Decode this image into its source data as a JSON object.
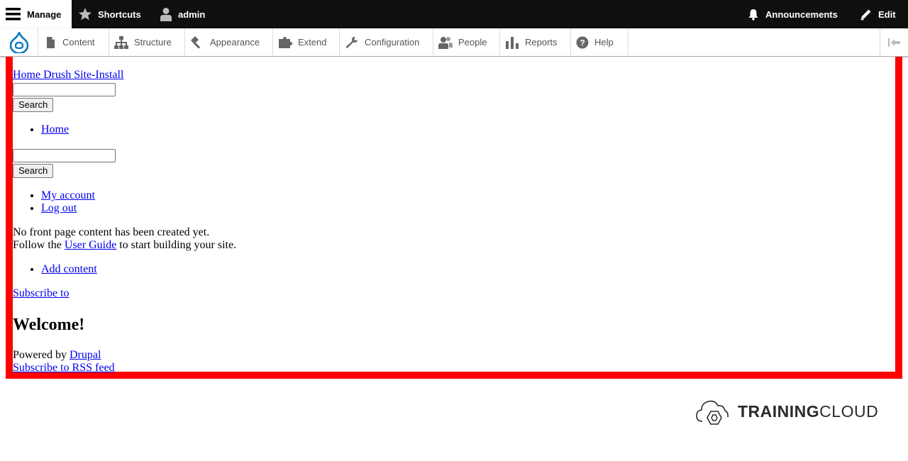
{
  "toolbar": {
    "manage": "Manage",
    "shortcuts": "Shortcuts",
    "user": "admin",
    "announcements": "Announcements",
    "edit": "Edit"
  },
  "tray": {
    "items": [
      {
        "label": "Content",
        "icon": "file-icon"
      },
      {
        "label": "Structure",
        "icon": "sitemap-icon"
      },
      {
        "label": "Appearance",
        "icon": "paintbrush-icon"
      },
      {
        "label": "Extend",
        "icon": "puzzle-icon"
      },
      {
        "label": "Configuration",
        "icon": "wrench-icon"
      },
      {
        "label": "People",
        "icon": "people-icon"
      },
      {
        "label": "Reports",
        "icon": "bar-chart-icon"
      },
      {
        "label": "Help",
        "icon": "help-icon"
      }
    ]
  },
  "page": {
    "home_link": "Home Drush Site-Install",
    "search_button": "Search",
    "main_nav": [
      "Home"
    ],
    "search_button_2": "Search",
    "account_menu": [
      "My account",
      "Log out"
    ],
    "no_content_text": "No front page content has been created yet.",
    "follow_prefix": "Follow the",
    "user_guide_link": "User Guide",
    "follow_suffix": "to start building your site.",
    "add_content_link": "Add content",
    "subscribe_link": "Subscribe to",
    "welcome_heading": "Welcome!",
    "powered_by": "Powered by",
    "drupal_link": "Drupal",
    "rss_link": "Subscribe to RSS feed"
  },
  "branding": {
    "logo_bold": "TRAINING",
    "logo_light": "CLOUD"
  },
  "colors": {
    "frame": "#ff0000",
    "toolbar": "#0f0f0f",
    "drupal_blue": "#0678be"
  }
}
